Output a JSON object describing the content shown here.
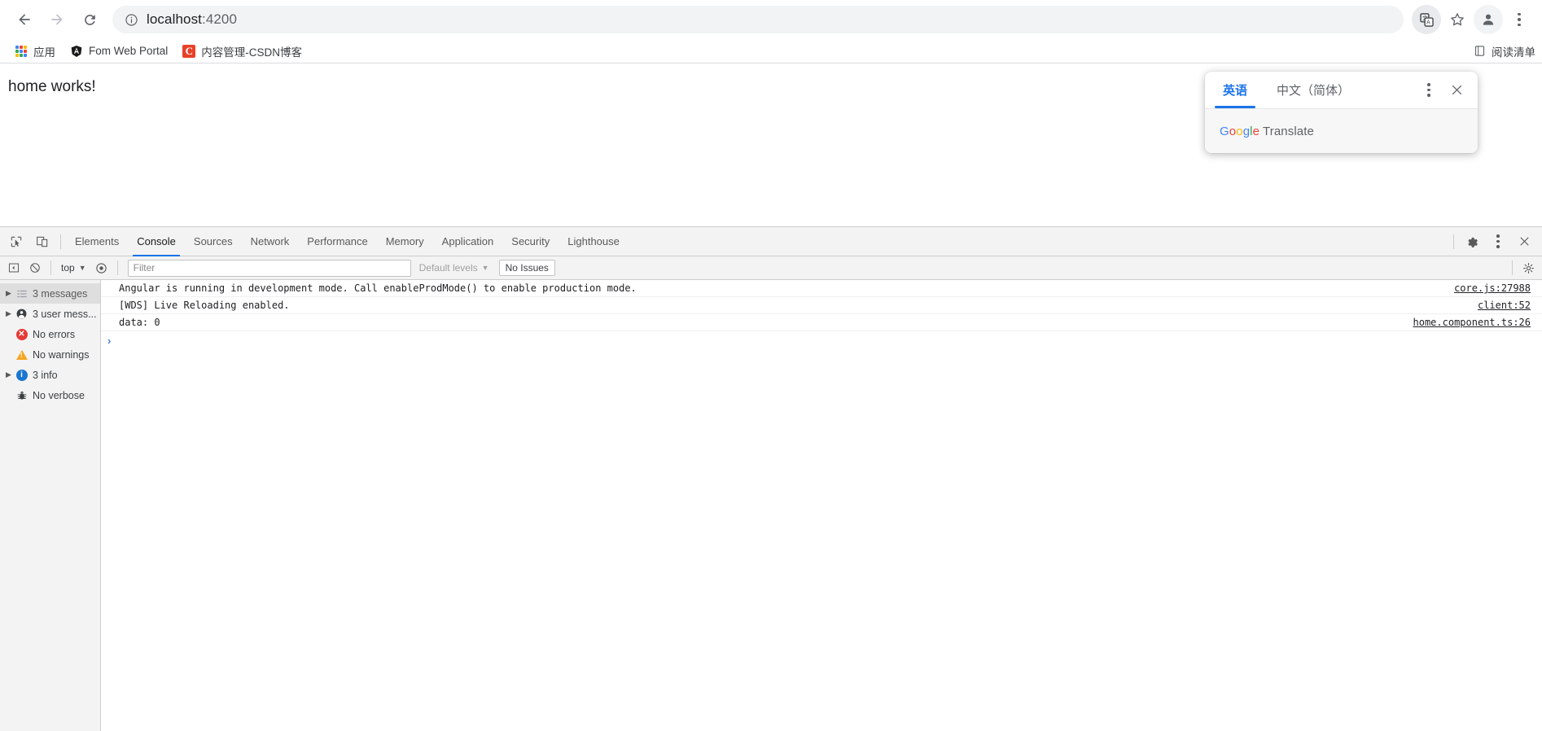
{
  "browser": {
    "nav": {
      "back_icon": "back-arrow-icon",
      "forward_icon": "forward-arrow-icon",
      "reload_icon": "reload-icon"
    },
    "omnibox": {
      "info_icon": "page-info-icon",
      "url_prefix": "localhost",
      "url_suffix": ":4200",
      "full_url": "localhost:4200"
    },
    "toolbar_icons": [
      {
        "name": "translate-icon",
        "active": true
      },
      {
        "name": "bookmark-star-icon",
        "active": false
      },
      {
        "name": "profile-avatar-icon",
        "active": false
      },
      {
        "name": "chrome-menu-icon",
        "active": false
      }
    ],
    "bookmarks": [
      {
        "label": "应用",
        "icon": "apps-grid-icon"
      },
      {
        "label": "Fom Web Portal",
        "icon": "angular-logo-icon"
      },
      {
        "label": "内容管理-CSDN博客",
        "icon": "csdn-logo-icon"
      }
    ],
    "reading_list": {
      "label": "阅读清单",
      "icon": "reading-list-icon"
    }
  },
  "translate_popup": {
    "tabs": [
      {
        "label": "英语",
        "selected": true
      },
      {
        "label": "中文（简体）",
        "selected": false
      }
    ],
    "more_icon": "kebab-menu-icon",
    "close_icon": "close-icon",
    "brand": {
      "g": "G",
      "oo": "oo",
      "g2": "g",
      "l": "l",
      "e": "e",
      "rest": " Translate",
      "full": "Google Translate"
    },
    "accent_color": "#1a73e8"
  },
  "page": {
    "heading": "home works!"
  },
  "devtools": {
    "left_icons": [
      {
        "name": "inspect-element-icon"
      },
      {
        "name": "device-toolbar-icon"
      }
    ],
    "tabs": [
      {
        "label": "Elements",
        "selected": false
      },
      {
        "label": "Console",
        "selected": true
      },
      {
        "label": "Sources",
        "selected": false
      },
      {
        "label": "Network",
        "selected": false
      },
      {
        "label": "Performance",
        "selected": false
      },
      {
        "label": "Memory",
        "selected": false
      },
      {
        "label": "Application",
        "selected": false
      },
      {
        "label": "Security",
        "selected": false
      },
      {
        "label": "Lighthouse",
        "selected": false
      }
    ],
    "right_icons": [
      {
        "name": "settings-gear-icon"
      },
      {
        "name": "devtools-more-icon"
      },
      {
        "name": "devtools-close-icon"
      }
    ],
    "filterbar": {
      "sidebar_toggle_icon": "console-sidebar-toggle-icon",
      "clear_icon": "clear-console-icon",
      "context": "top",
      "context_caret": "▼",
      "eye_icon": "live-expression-icon",
      "filter_placeholder": "Filter",
      "filter_value": "",
      "levels_label": "Default levels",
      "levels_caret": "▼",
      "issues_label": "No Issues",
      "settings_icon": "console-settings-icon"
    },
    "sidebar": [
      {
        "label": "3 messages",
        "icon": "list-icon",
        "twisty": true,
        "selected": true
      },
      {
        "label": "3 user mess...",
        "icon": "user-icon",
        "twisty": true,
        "selected": false
      },
      {
        "label": "No errors",
        "icon": "error-icon",
        "twisty": false,
        "selected": false
      },
      {
        "label": "No warnings",
        "icon": "warning-icon",
        "twisty": false,
        "selected": false
      },
      {
        "label": "3 info",
        "icon": "info-icon",
        "twisty": true,
        "selected": false
      },
      {
        "label": "No verbose",
        "icon": "verbose-bug-icon",
        "twisty": false,
        "selected": false
      }
    ],
    "messages": [
      {
        "text": "Angular is running in development mode. Call enableProdMode() to enable production mode.",
        "source": "core.js:27988"
      },
      {
        "text": "[WDS] Live Reloading enabled.",
        "source": "client:52"
      },
      {
        "text": "data: 0",
        "source": "home.component.ts:26"
      }
    ],
    "prompt_caret": "›"
  }
}
